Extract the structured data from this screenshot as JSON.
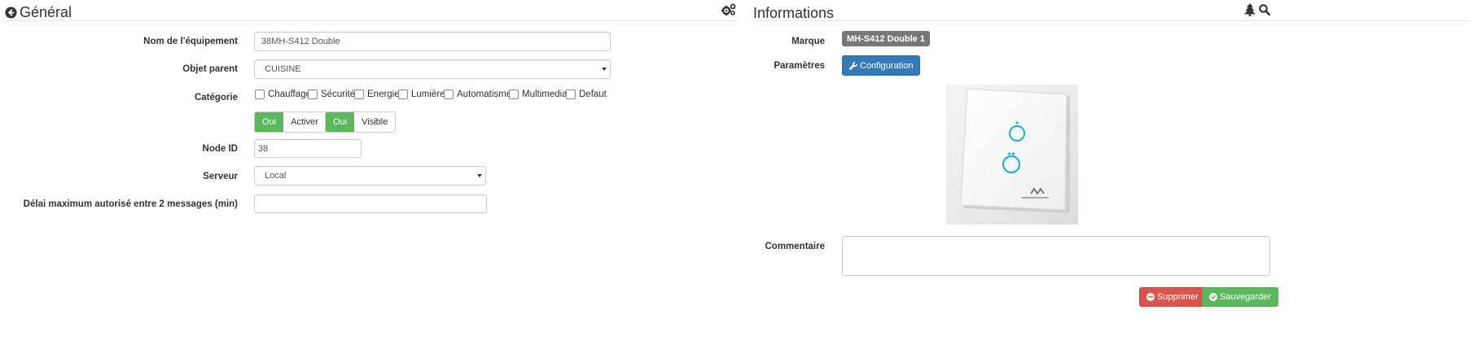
{
  "general": {
    "title": "Général",
    "labels": {
      "name": "Nom de l'équipement",
      "parent": "Objet parent",
      "category": "Catégorie",
      "node_id": "Node ID",
      "server": "Serveur",
      "delay": "Délai maximum autorisé entre 2 messages (min)"
    },
    "fields": {
      "name_value": "38MH-S412 Double",
      "parent_value": "CUISINE",
      "node_id_value": "38",
      "server_value": "Local",
      "delay_value": ""
    },
    "categories": [
      "Chauffage",
      "Sécurité",
      "Energie",
      "Lumière",
      "Automatisme",
      "Multimedia",
      "Defaut"
    ],
    "toggles": {
      "active_on": "Oui",
      "active_label": "Activer",
      "visible_on": "Oui",
      "visible_label": "Visible"
    }
  },
  "informations": {
    "title": "Informations",
    "labels": {
      "brand": "Marque",
      "params": "Paramètres",
      "comment": "Commentaire"
    },
    "brand_badge": "MH-S412 Double 1",
    "config_button": "Configuration",
    "comment_value": ""
  },
  "actions": {
    "delete": "Supprimer",
    "save": "Sauvegarder"
  },
  "colors": {
    "success": "#5cb85c",
    "primary": "#337ab7",
    "danger": "#d9534f",
    "badge": "#777777",
    "accent": "#1fb6d0"
  },
  "icons": [
    "arrow-circle-left-icon",
    "cogs-icon",
    "tree-icon",
    "search-icon",
    "wrench-icon",
    "minus-circle-icon",
    "check-circle-icon"
  ]
}
